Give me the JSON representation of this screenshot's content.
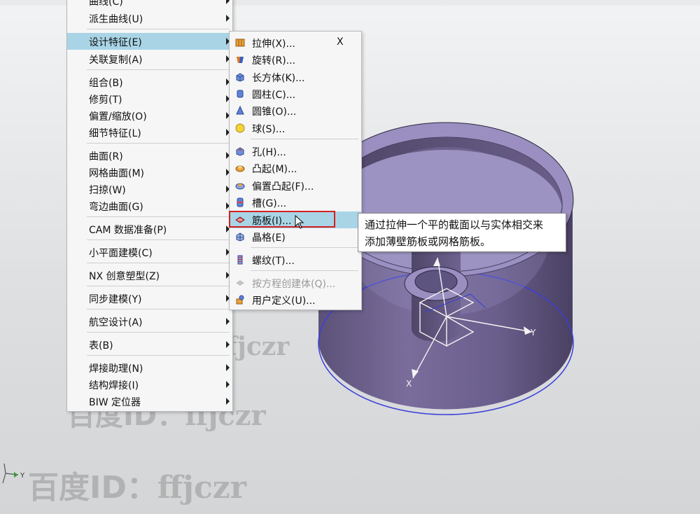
{
  "main_menu": {
    "items": [
      {
        "label": "曲线(C)",
        "arrow": true
      },
      {
        "label": "派生曲线(U)",
        "arrow": true
      },
      {
        "label": "设计特征(E)",
        "arrow": true
      },
      {
        "label": "关联复制(A)",
        "arrow": true
      },
      {
        "label": "组合(B)",
        "arrow": true
      },
      {
        "label": "修剪(T)",
        "arrow": true
      },
      {
        "label": "偏置/缩放(O)",
        "arrow": true
      },
      {
        "label": "细节特征(L)",
        "arrow": true
      },
      {
        "label": "曲面(R)",
        "arrow": true
      },
      {
        "label": "网格曲面(M)",
        "arrow": true
      },
      {
        "label": "扫掠(W)",
        "arrow": true
      },
      {
        "label": "弯边曲面(G)",
        "arrow": true
      },
      {
        "label": "CAM 数据准备(P)",
        "arrow": true
      },
      {
        "label": "小平面建模(C)",
        "arrow": true
      },
      {
        "label": "NX 创意塑型(Z)",
        "arrow": true
      },
      {
        "label": "同步建模(Y)",
        "arrow": true
      },
      {
        "label": "航空设计(A)",
        "arrow": true
      },
      {
        "label": "表(B)",
        "arrow": true
      },
      {
        "label": "焊接助理(N)",
        "arrow": true
      },
      {
        "label": "结构焊接(I)",
        "arrow": true
      },
      {
        "label": "BIW 定位器",
        "arrow": true
      }
    ],
    "highlighted": "设计特征(E)"
  },
  "sub_menu": {
    "items": [
      {
        "label": "拉伸(X)...",
        "shortcut": "X",
        "icon": "extrude-icon"
      },
      {
        "label": "旋转(R)...",
        "icon": "revolve-icon"
      },
      {
        "label": "长方体(K)...",
        "icon": "block-icon"
      },
      {
        "label": "圆柱(C)...",
        "icon": "cylinder-icon"
      },
      {
        "label": "圆锥(O)...",
        "icon": "cone-icon"
      },
      {
        "label": "球(S)...",
        "icon": "sphere-icon"
      },
      {
        "label": "孔(H)...",
        "icon": "hole-icon"
      },
      {
        "label": "凸起(M)...",
        "icon": "emboss-icon"
      },
      {
        "label": "偏置凸起(F)...",
        "icon": "offset-emboss-icon"
      },
      {
        "label": "槽(G)...",
        "icon": "groove-icon"
      },
      {
        "label": "筋板(I)...",
        "icon": "rib-icon"
      },
      {
        "label": "晶格(E)",
        "icon": "lattice-icon"
      },
      {
        "label": "螺纹(T)...",
        "icon": "thread-icon"
      },
      {
        "label": "按方程创建体(Q)...",
        "icon": "equation-body-icon",
        "disabled": true
      },
      {
        "label": "用户定义(U)...",
        "icon": "user-defined-icon"
      }
    ],
    "highlighted": "筋板(I)..."
  },
  "tooltip": {
    "line1": "通过拉伸一个平的截面以与实体相交来",
    "line2": "添加薄壁筋板或网格筋板。"
  },
  "viewport": {
    "axis_x_label": "X",
    "axis_y_label": "Y",
    "triad_y_label": "Y",
    "colors": {
      "model": "#7d6fa2",
      "model_dark": "#4f4566",
      "edge": "#3a3fd8",
      "highlight_box": "#d42020"
    }
  },
  "watermark": {
    "text_a": "百度ID：",
    "text_b": "ffjczr"
  }
}
